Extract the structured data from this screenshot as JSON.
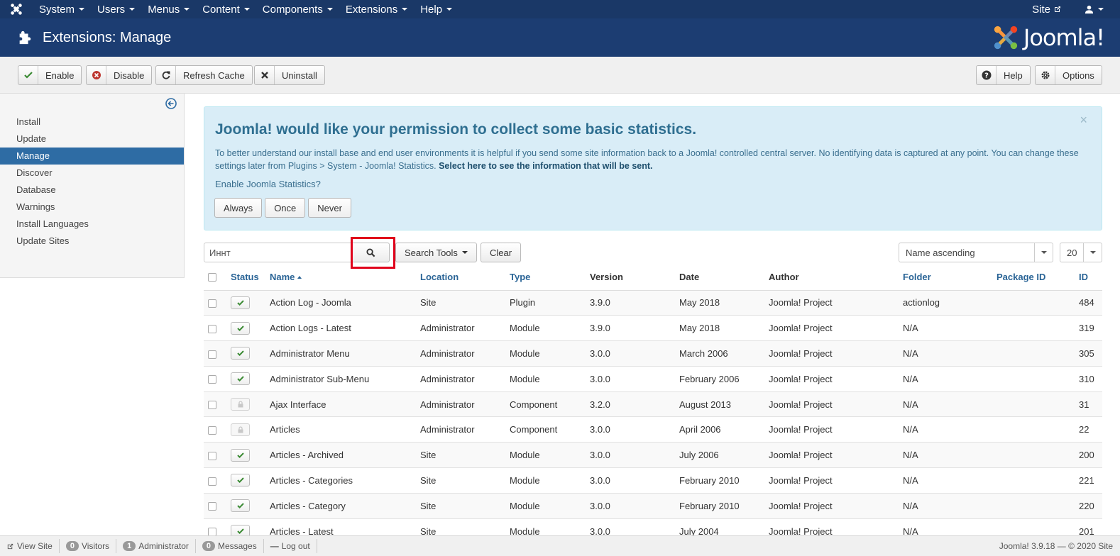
{
  "nav": {
    "menus": [
      "System",
      "Users",
      "Menus",
      "Content",
      "Components",
      "Extensions",
      "Help"
    ],
    "site_label": "Site"
  },
  "header": {
    "title": "Extensions: Manage",
    "brand": "Joomla!"
  },
  "toolbar": {
    "enable": "Enable",
    "disable": "Disable",
    "refresh_cache": "Refresh Cache",
    "uninstall": "Uninstall",
    "help": "Help",
    "options": "Options"
  },
  "sidebar": {
    "items": [
      "Install",
      "Update",
      "Manage",
      "Discover",
      "Database",
      "Warnings",
      "Install Languages",
      "Update Sites"
    ],
    "active": "Manage"
  },
  "stats": {
    "title": "Joomla! would like your permission to collect some basic statistics.",
    "message": "To better understand our install base and end user environments it is helpful if you send some site information back to a Joomla! controlled central server. No identifying data is captured at any point. You can change these settings later from Plugins > System - Joomla! Statistics.",
    "link": "Select here to see the information that will be sent.",
    "question": "Enable Joomla Statistics?",
    "always": "Always",
    "once": "Once",
    "never": "Never"
  },
  "filters": {
    "search_value": "Иннт",
    "search_tools": "Search Tools",
    "clear": "Clear",
    "ordering": "Name ascending",
    "limit": "20"
  },
  "table": {
    "headers": [
      "Status",
      "Name",
      "Location",
      "Type",
      "Version",
      "Date",
      "Author",
      "Folder",
      "Package ID",
      "ID"
    ],
    "rows": [
      {
        "status": "enabled",
        "name": "Action Log - Joomla",
        "location": "Site",
        "type": "Plugin",
        "version": "3.9.0",
        "date": "May 2018",
        "author": "Joomla! Project",
        "folder": "actionlog",
        "package": "",
        "id": "484"
      },
      {
        "status": "enabled",
        "name": "Action Logs - Latest",
        "location": "Administrator",
        "type": "Module",
        "version": "3.9.0",
        "date": "May 2018",
        "author": "Joomla! Project",
        "folder": "N/A",
        "package": "",
        "id": "319"
      },
      {
        "status": "enabled",
        "name": "Administrator Menu",
        "location": "Administrator",
        "type": "Module",
        "version": "3.0.0",
        "date": "March 2006",
        "author": "Joomla! Project",
        "folder": "N/A",
        "package": "",
        "id": "305"
      },
      {
        "status": "enabled",
        "name": "Administrator Sub-Menu",
        "location": "Administrator",
        "type": "Module",
        "version": "3.0.0",
        "date": "February 2006",
        "author": "Joomla! Project",
        "folder": "N/A",
        "package": "",
        "id": "310"
      },
      {
        "status": "locked",
        "name": "Ajax Interface",
        "location": "Administrator",
        "type": "Component",
        "version": "3.2.0",
        "date": "August 2013",
        "author": "Joomla! Project",
        "folder": "N/A",
        "package": "",
        "id": "31"
      },
      {
        "status": "locked",
        "name": "Articles",
        "location": "Administrator",
        "type": "Component",
        "version": "3.0.0",
        "date": "April 2006",
        "author": "Joomla! Project",
        "folder": "N/A",
        "package": "",
        "id": "22"
      },
      {
        "status": "enabled",
        "name": "Articles - Archived",
        "location": "Site",
        "type": "Module",
        "version": "3.0.0",
        "date": "July 2006",
        "author": "Joomla! Project",
        "folder": "N/A",
        "package": "",
        "id": "200"
      },
      {
        "status": "enabled",
        "name": "Articles - Categories",
        "location": "Site",
        "type": "Module",
        "version": "3.0.0",
        "date": "February 2010",
        "author": "Joomla! Project",
        "folder": "N/A",
        "package": "",
        "id": "221"
      },
      {
        "status": "enabled",
        "name": "Articles - Category",
        "location": "Site",
        "type": "Module",
        "version": "3.0.0",
        "date": "February 2010",
        "author": "Joomla! Project",
        "folder": "N/A",
        "package": "",
        "id": "220"
      },
      {
        "status": "enabled",
        "name": "Articles - Latest",
        "location": "Site",
        "type": "Module",
        "version": "3.0.0",
        "date": "July 2004",
        "author": "Joomla! Project",
        "folder": "N/A",
        "package": "",
        "id": "201"
      }
    ]
  },
  "statusbar": {
    "view_site": "View Site",
    "visitors_count": "0",
    "visitors": "Visitors",
    "admin_count": "1",
    "administrator": "Administrator",
    "messages_count": "0",
    "messages": "Messages",
    "logout": "Log out",
    "version": "Joomla! 3.9.18 — © 2020 Site"
  }
}
